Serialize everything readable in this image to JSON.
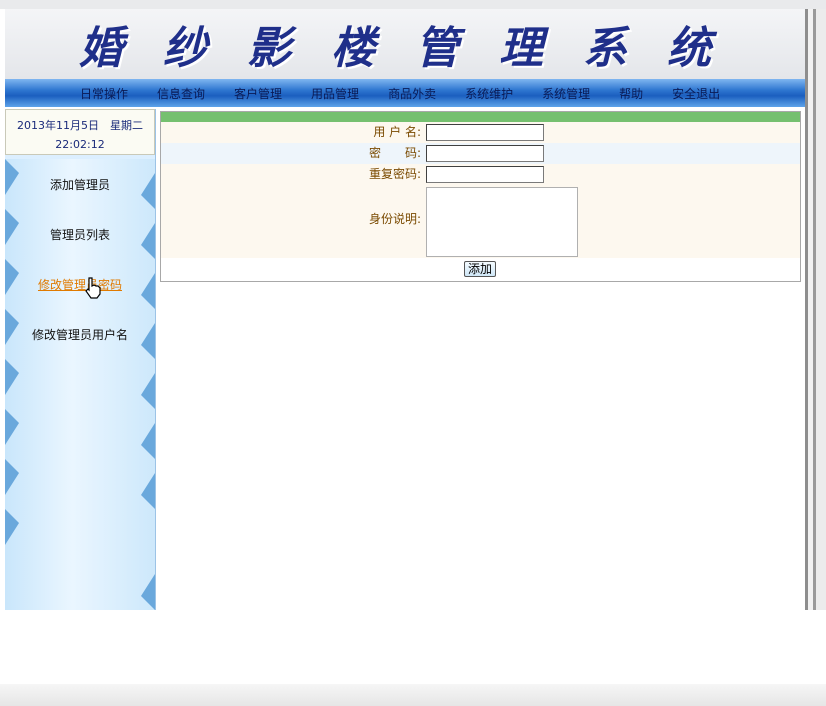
{
  "header": {
    "title": "婚纱影楼管理系统"
  },
  "nav": {
    "items": [
      "日常操作",
      "信息查询",
      "客户管理",
      "用品管理",
      "商品外卖",
      "系统维护",
      "系统管理",
      "帮助",
      "安全退出"
    ]
  },
  "datebox": {
    "date": "2013年11月5日　星期二",
    "time": "22:02:12"
  },
  "sidebar": {
    "items": [
      "添加管理员",
      "管理员列表",
      "修改管理员密码",
      "修改管理员用户名"
    ],
    "active_index": 2
  },
  "form": {
    "username_label": "用 户 名:",
    "password_label": "密　　码:",
    "repeat_label": "重复密码:",
    "desc_label": "身份说明:",
    "username_value": "",
    "password_value": "",
    "repeat_value": "",
    "desc_value": "",
    "submit_label": "添加"
  },
  "colors": {
    "nav": "#2e76d0",
    "title": "#1f2f8a",
    "accent_bar": "#75c06f",
    "label": "#7a4a00",
    "active_link": "#e07a00"
  }
}
